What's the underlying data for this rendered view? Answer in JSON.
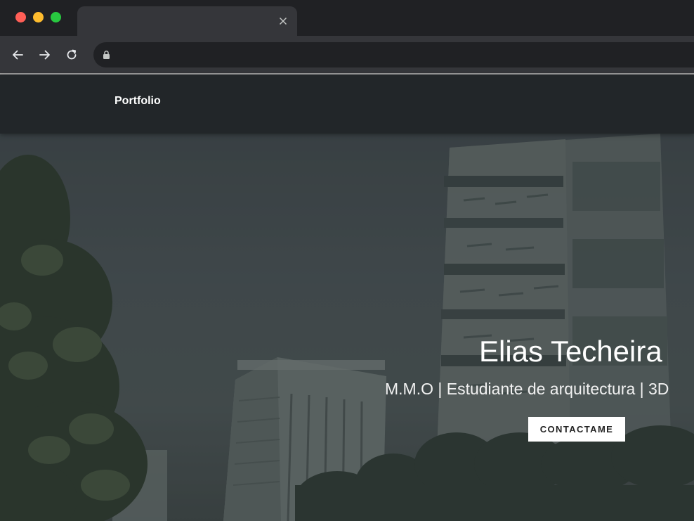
{
  "browser": {
    "tab_title": "",
    "url": "",
    "icons": {
      "close_tab": "close-icon",
      "back": "arrow-left-icon",
      "forward": "arrow-right-icon",
      "reload": "reload-icon",
      "lock": "lock-icon"
    },
    "traffic_lights": {
      "close": "#ff5f57",
      "minimize": "#febc2e",
      "maximize": "#28c840"
    }
  },
  "site": {
    "brand": "Portfolio",
    "nav_bg": "#222629"
  },
  "hero": {
    "title": "Elias Techeira",
    "subtitle": "M.M.O | Estudiante de arquitectura | 3D",
    "cta_label": "CONTACTAME"
  }
}
